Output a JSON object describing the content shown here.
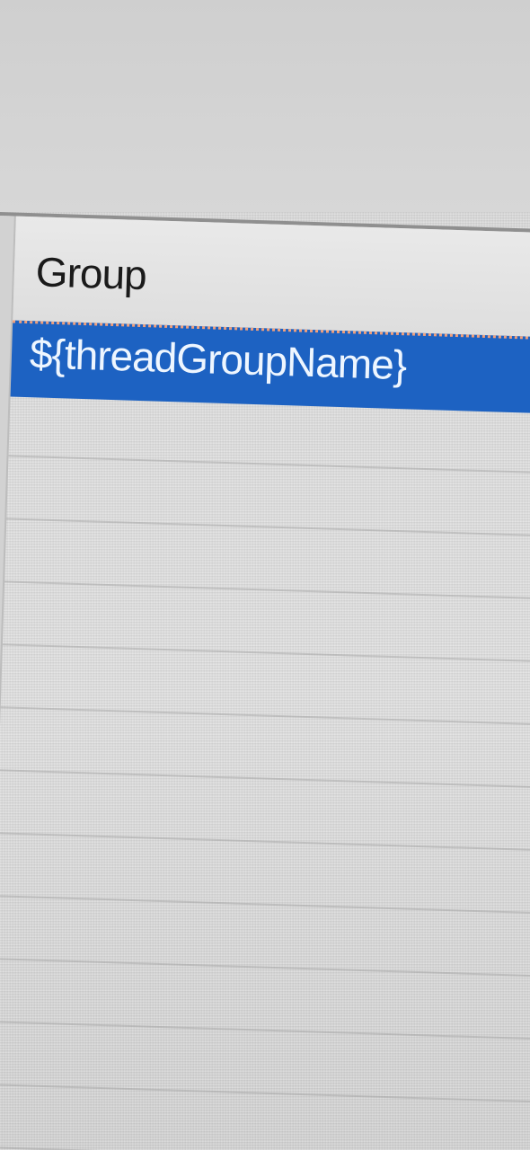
{
  "table": {
    "columns": [
      {
        "label": "Group"
      }
    ],
    "rows": [
      {
        "group": "${threadGroupName}",
        "selected": true
      }
    ]
  },
  "colors": {
    "selection": "#1d62c2",
    "selection_text": "#eef6ff",
    "header_text": "#1a1a1a"
  }
}
